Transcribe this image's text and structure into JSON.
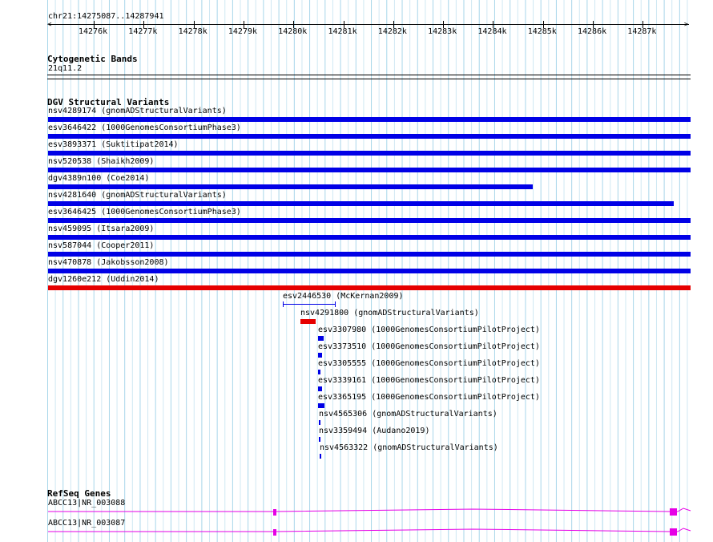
{
  "view": {
    "locus": "chr21:14275087..14287941",
    "ticks": [
      "14276k",
      "14277k",
      "14278k",
      "14279k",
      "14280k",
      "14281k",
      "14282k",
      "14283k",
      "14284k",
      "14285k",
      "14286k",
      "14287k"
    ]
  },
  "cytoband": {
    "title": "Cytogenetic Bands",
    "band": "21q11.2"
  },
  "dgv": {
    "title": "DGV Structural Variants",
    "colors": {
      "loss": "#0000e6",
      "gain": "#e60000"
    },
    "features": [
      {
        "label": "nsv4289174 (gnomADStructuralVariants)",
        "kind": "loss",
        "style": "bar"
      },
      {
        "label": "esv3646422 (1000GenomesConsortiumPhase3)",
        "kind": "loss",
        "style": "bar"
      },
      {
        "label": "esv3893371 (Suktitipat2014)",
        "kind": "loss",
        "style": "bar"
      },
      {
        "label": "nsv520538 (Shaikh2009)",
        "kind": "loss",
        "style": "bar"
      },
      {
        "label": "dgv4389n100 (Coe2014)",
        "kind": "loss",
        "style": "bar"
      },
      {
        "label": "nsv4281640 (gnomADStructuralVariants)",
        "kind": "loss",
        "style": "bar"
      },
      {
        "label": "esv3646425 (1000GenomesConsortiumPhase3)",
        "kind": "loss",
        "style": "bar"
      },
      {
        "label": "nsv459095 (Itsara2009)",
        "kind": "loss",
        "style": "bar"
      },
      {
        "label": "nsv587044 (Cooper2011)",
        "kind": "loss",
        "style": "bar"
      },
      {
        "label": "nsv470878 (Jakobsson2008)",
        "kind": "loss",
        "style": "bar"
      },
      {
        "label": "dgv1260e212 (Uddin2014)",
        "kind": "gain",
        "style": "bar"
      },
      {
        "label": "esv2446530 (McKernan2009)",
        "kind": "loss",
        "style": "line"
      },
      {
        "label": "nsv4291800 (gnomADStructuralVariants)",
        "kind": "gain",
        "style": "bar"
      },
      {
        "label": "esv3307980 (1000GenomesConsortiumPilotProject)",
        "kind": "loss",
        "style": "bar"
      },
      {
        "label": "esv3373510 (1000GenomesConsortiumPilotProject)",
        "kind": "loss",
        "style": "bar"
      },
      {
        "label": "esv3305555 (1000GenomesConsortiumPilotProject)",
        "kind": "loss",
        "style": "bar"
      },
      {
        "label": "esv3339161 (1000GenomesConsortiumPilotProject)",
        "kind": "loss",
        "style": "bar"
      },
      {
        "label": "esv3365195 (1000GenomesConsortiumPilotProject)",
        "kind": "loss",
        "style": "bar"
      },
      {
        "label": "nsv4565306 (gnomADStructuralVariants)",
        "kind": "loss",
        "style": "bar"
      },
      {
        "label": "nsv3359494 (Audano2019)",
        "kind": "loss",
        "style": "bar"
      },
      {
        "label": "nsv4563322 (gnomADStructuralVariants)",
        "kind": "loss",
        "style": "bar"
      }
    ]
  },
  "refseq": {
    "title": "RefSeq Genes",
    "color": "#e600e6",
    "transcripts": [
      {
        "label": "ABCC13|NR_003088"
      },
      {
        "label": "ABCC13|NR_003087"
      }
    ]
  }
}
